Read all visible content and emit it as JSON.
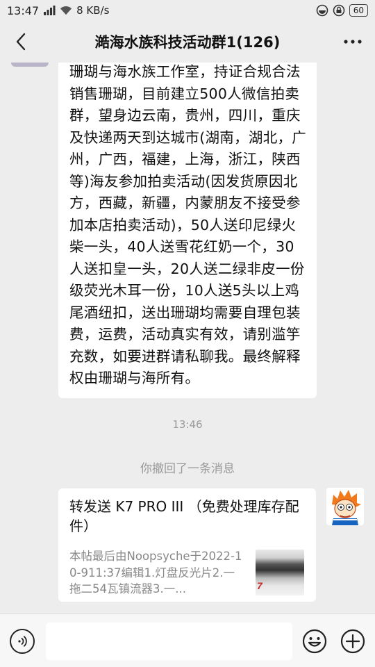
{
  "status_bar": {
    "time": "13:47",
    "speed": "8 KB/s",
    "battery": "60"
  },
  "header": {
    "title": "澔海水族科技活动群1(126)",
    "back_icon": "chevron-left-icon",
    "more_icon": "more-dots-icon"
  },
  "messages": {
    "announcement": "珊瑚与海水族工作室，持证合规合法销售珊瑚，目前建立500人微信拍卖群，望身边云南，贵州，四川，重庆及快递两天到达城市(湖南，湖北，广州，广西，福建，上海，浙江，陕西等)海友参加拍卖活动(因发货原因北方，西藏，新疆，内蒙朋友不接受参加本店拍卖活动)，50人送印尼绿火柴一头，40人送雪花红奶一个，30人送扣皇一头，20人送二绿非皮一份级荧光木耳一份，10人送5头以上鸡尾酒纽扣，送出珊瑚均需要自理包装费，运费，活动真实有效，请别滥竽充数，如要进群请私聊我。最终解释权由珊瑚与海所有。",
    "timestamp": "13:46",
    "recall_notice": "你撤回了一条消息",
    "link_card": {
      "title": "转发送 K7 PRO III （免费处理库存配件）",
      "body": "本帖最后由Noopsyche于2022-10-911:37编辑1.灯盘反光片2.一拖二54瓦镇流器3.一...",
      "thumb_label": "7"
    }
  },
  "input_bar": {
    "placeholder": "",
    "voice_icon": "voice-icon",
    "emoji_icon": "emoji-icon",
    "plus_icon": "plus-icon"
  },
  "colors": {
    "background": "#ededed",
    "bubble": "#ffffff",
    "meta_text": "#9a9a9a"
  }
}
